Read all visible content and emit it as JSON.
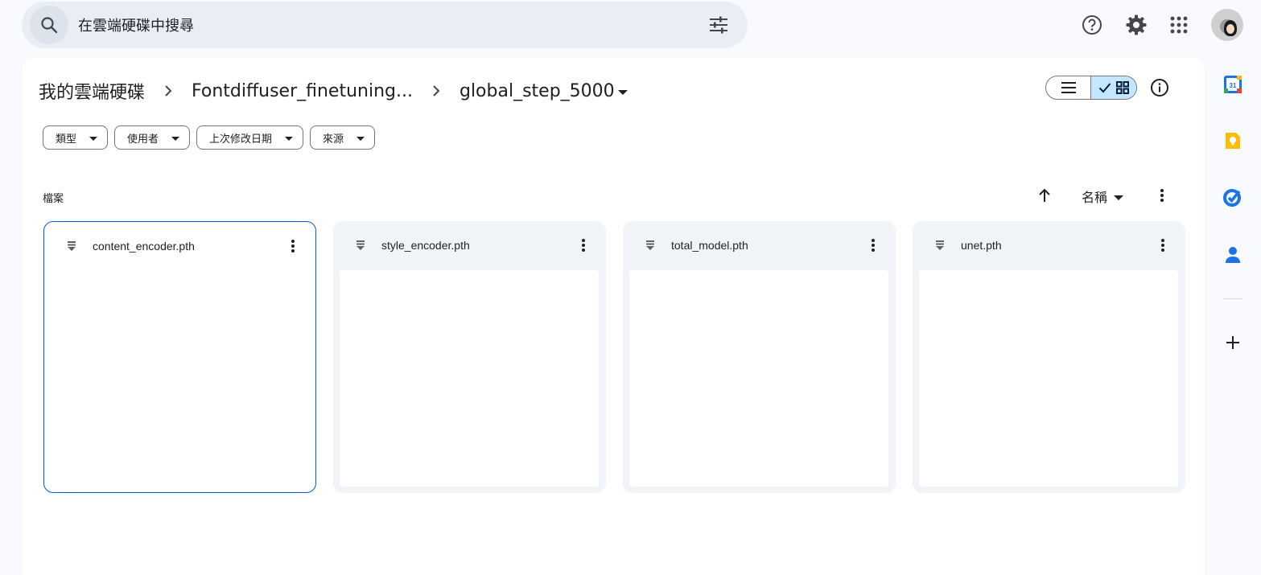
{
  "search": {
    "placeholder": "在雲端硬碟中搜尋"
  },
  "topbar": {
    "icons": [
      "help-icon",
      "settings-icon",
      "apps-grid-icon"
    ]
  },
  "breadcrumb": {
    "items": [
      {
        "label": "我的雲端硬碟"
      },
      {
        "label": "Fontdiffuser_finetuning..."
      },
      {
        "label": "global_step_5000"
      }
    ]
  },
  "view": {
    "mode": "grid",
    "accent": "#c2e7ff"
  },
  "filters": [
    {
      "label": "類型"
    },
    {
      "label": "使用者"
    },
    {
      "label": "上次修改日期"
    },
    {
      "label": "來源"
    }
  ],
  "section": {
    "title": "檔案"
  },
  "sort": {
    "label": "名稱",
    "direction": "ascending"
  },
  "files": [
    {
      "name": "content_encoder.pth",
      "selected": true
    },
    {
      "name": "style_encoder.pth",
      "selected": false
    },
    {
      "name": "total_model.pth",
      "selected": false
    },
    {
      "name": "unet.pth",
      "selected": false
    }
  ],
  "side_panel": {
    "apps": [
      "calendar-icon",
      "keep-icon",
      "tasks-icon",
      "contacts-icon"
    ],
    "calendar_day": "31",
    "colors": {
      "calendar": "#1a73e8",
      "keep": "#fbbc04",
      "tasks": "#1a73e8",
      "contacts": "#1a73e8"
    }
  }
}
